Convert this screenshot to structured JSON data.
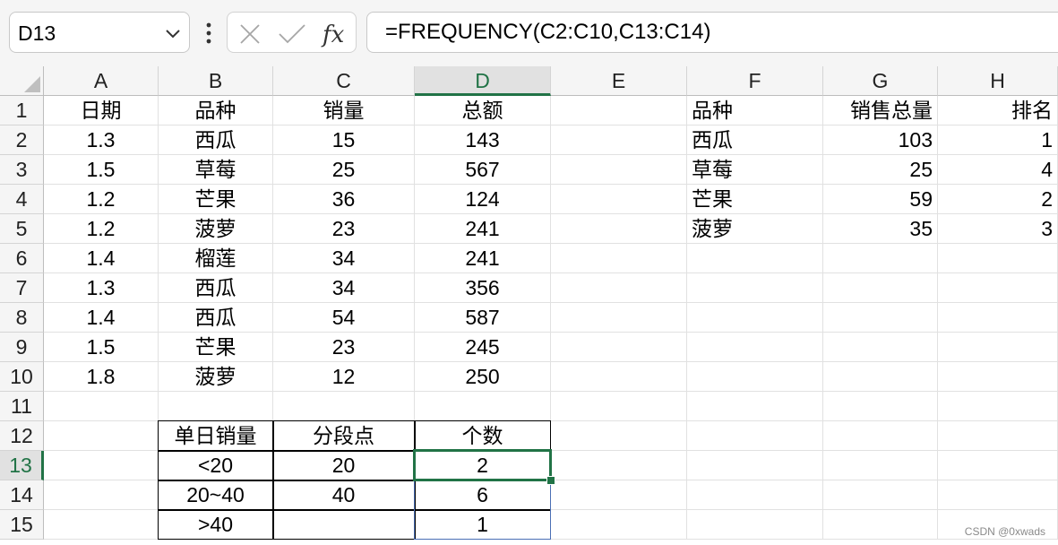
{
  "formula_bar": {
    "name_box": "D13",
    "cancel_icon": "close-icon",
    "enter_icon": "checkmark-icon",
    "function_icon": "fx-icon",
    "formula": "=FREQUENCY(C2:C10,C13:C14)"
  },
  "columns": [
    "A",
    "B",
    "C",
    "D",
    "E",
    "F",
    "G",
    "H"
  ],
  "rows": [
    "1",
    "2",
    "3",
    "4",
    "5",
    "6",
    "7",
    "8",
    "9",
    "10",
    "11",
    "12",
    "13",
    "14",
    "15"
  ],
  "sheet": {
    "A": [
      "日期",
      "1.3",
      "1.5",
      "1.2",
      "1.2",
      "1.4",
      "1.3",
      "1.4",
      "1.5",
      "1.8",
      "",
      "",
      "",
      "",
      ""
    ],
    "B": [
      "品种",
      "西瓜",
      "草莓",
      "芒果",
      "菠萝",
      "榴莲",
      "西瓜",
      "西瓜",
      "芒果",
      "菠萝",
      "",
      "单日销量",
      "<20",
      "20~40",
      ">40"
    ],
    "C": [
      "销量",
      "15",
      "25",
      "36",
      "23",
      "34",
      "34",
      "54",
      "23",
      "12",
      "",
      "分段点",
      "20",
      "40",
      ""
    ],
    "D": [
      "总额",
      "143",
      "567",
      "124",
      "241",
      "241",
      "356",
      "587",
      "245",
      "250",
      "",
      "个数",
      "2",
      "6",
      "1"
    ],
    "E": [
      "",
      "",
      "",
      "",
      "",
      "",
      "",
      "",
      "",
      "",
      "",
      "",
      "",
      "",
      ""
    ],
    "F": [
      "品种",
      "西瓜",
      "草莓",
      "芒果",
      "菠萝",
      "",
      "",
      "",
      "",
      "",
      "",
      "",
      "",
      "",
      ""
    ],
    "G": [
      "销售总量",
      "103",
      "25",
      "59",
      "35",
      "",
      "",
      "",
      "",
      "",
      "",
      "",
      "",
      "",
      ""
    ],
    "H": [
      "排名",
      "1",
      "4",
      "2",
      "3",
      "",
      "",
      "",
      "",
      "",
      "",
      "",
      "",
      "",
      ""
    ]
  },
  "selection": {
    "cell": "D13",
    "column": "D",
    "row": "13"
  },
  "colors": {
    "accent": "#217346",
    "grid": "#e1e1e1",
    "header_bg": "#f5f5f5"
  },
  "watermark": "CSDN @0xwads"
}
